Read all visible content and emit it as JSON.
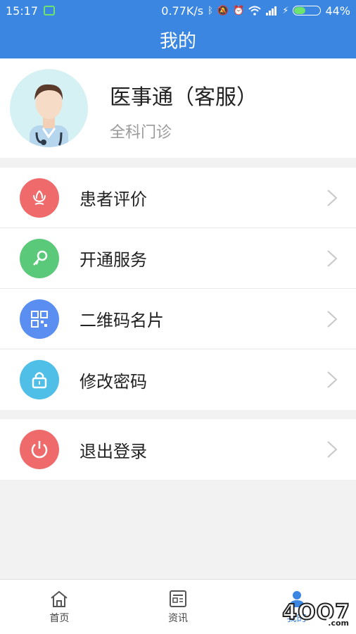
{
  "status_bar": {
    "time": "15:17",
    "speed": "0.77K/s",
    "battery": "44%",
    "battery_level": 0.44,
    "icons": [
      "wechat-icon",
      "bluetooth-icon",
      "mute-icon",
      "alarm-icon",
      "wifi-icon",
      "signal-icon",
      "charging-icon"
    ]
  },
  "header": {
    "title": "我的"
  },
  "profile": {
    "name": "医事通（客服）",
    "department": "全科门诊",
    "avatar_icon": "doctor-avatar-icon"
  },
  "menu": {
    "items": [
      {
        "label": "患者评价",
        "icon": "flower-icon",
        "color": "#ef6b6b"
      },
      {
        "label": "开通服务",
        "icon": "key-icon",
        "color": "#5bc97a"
      },
      {
        "label": "二维码名片",
        "icon": "qrcode-icon",
        "color": "#5a8ef0"
      },
      {
        "label": "修改密码",
        "icon": "lock-icon",
        "color": "#4fbfe8"
      }
    ],
    "logout": {
      "label": "退出登录",
      "icon": "power-icon",
      "color": "#ef6b6b"
    }
  },
  "tab_bar": {
    "tabs": [
      {
        "label": "首页",
        "icon": "home-icon"
      },
      {
        "label": "资讯",
        "icon": "news-icon"
      },
      {
        "label": "我的",
        "icon": "user-icon",
        "active": true
      }
    ]
  },
  "watermark": {
    "text": "4OO7",
    "suffix": ".com"
  },
  "colors": {
    "primary": "#3a86e0",
    "background": "#f2f2f2"
  }
}
